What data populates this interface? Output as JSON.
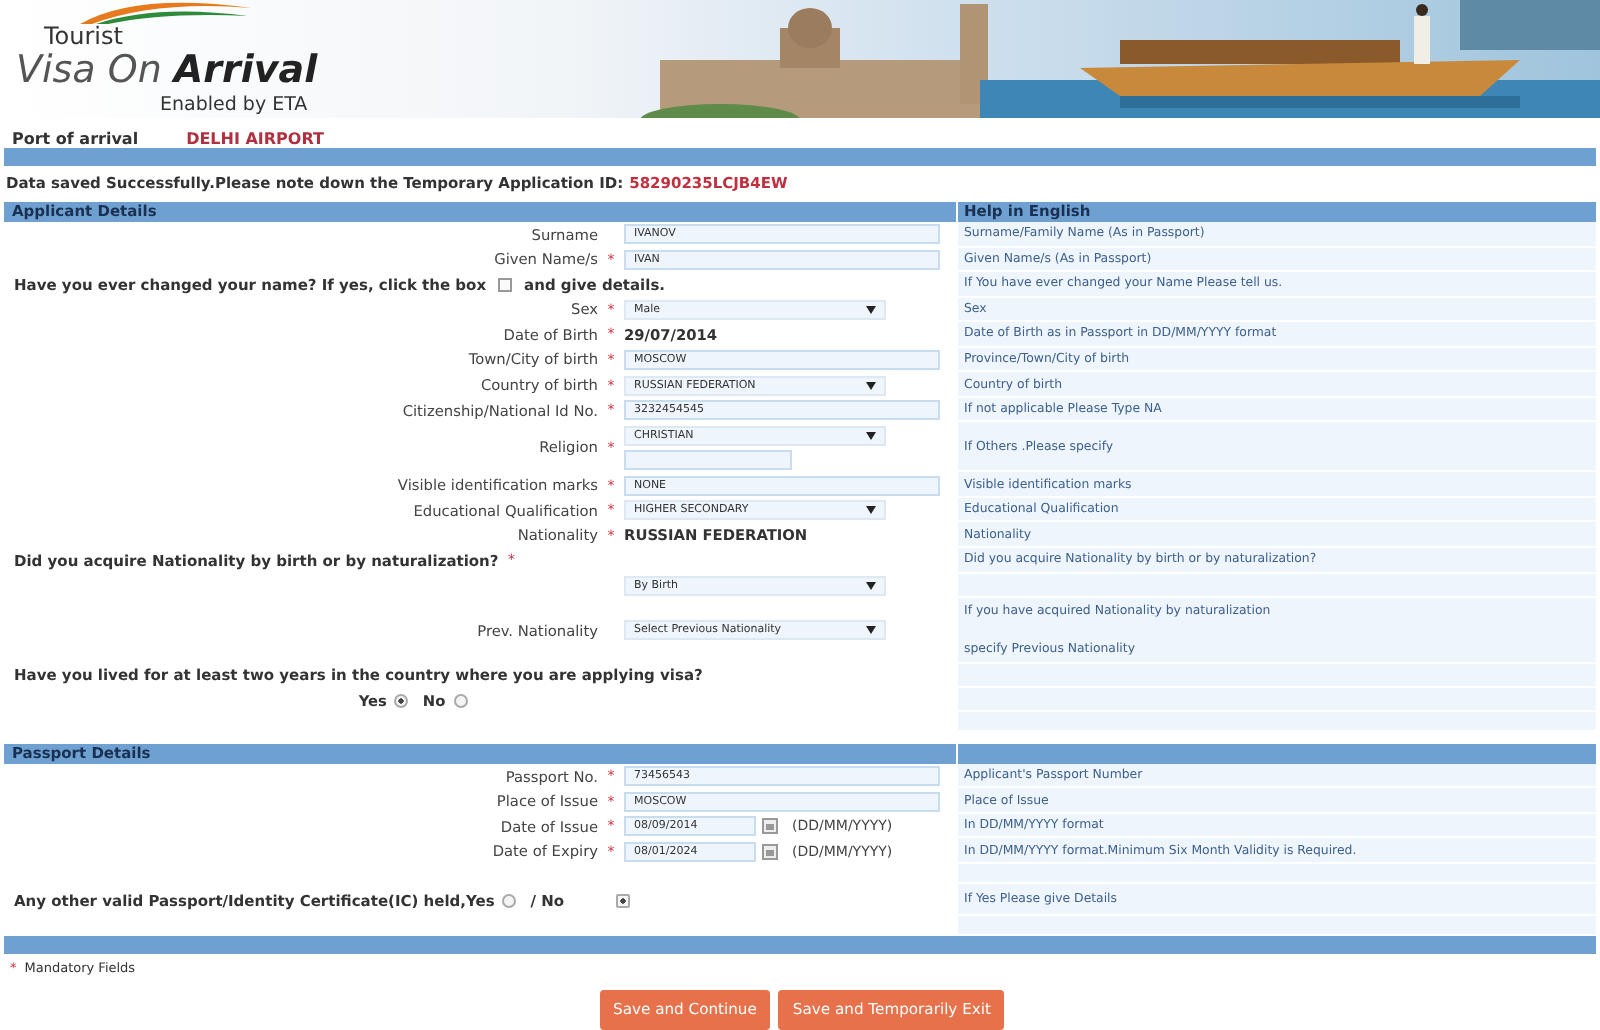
{
  "header": {
    "logo_small": "Tourist",
    "logo_title": "Visa On **Arrival**",
    "logo_tagline": "Enabled by ETA"
  },
  "port": {
    "label": "Port of arrival",
    "value": "DELHI AIRPORT"
  },
  "message": {
    "text": "Data saved Successfully.Please note down the Temporary Application ID:",
    "id": "58290235LCJB4EW"
  },
  "required_mark": "*",
  "sections": [
    {
      "title": "Applicant Details",
      "help_title": "Help in English",
      "rows": [
        {
          "kind": "input",
          "label": "Surname",
          "required": false,
          "value": "IVANOV",
          "help": [
            "Surname/Family Name (As in Passport)"
          ]
        },
        {
          "kind": "input",
          "label": "Given Name/s",
          "required": true,
          "value": "IVAN",
          "help": [
            "Given Name/s (As in Passport)"
          ]
        },
        {
          "kind": "checkbox_question",
          "text": "Have you ever changed your name? If yes, click the box",
          "text_after": "and give details.",
          "checked": false,
          "help": [
            "If You have ever changed your Name Please tell us."
          ]
        },
        {
          "kind": "select",
          "label": "Sex",
          "required": true,
          "value": "Male",
          "help": [
            "Sex"
          ]
        },
        {
          "kind": "static",
          "label": "Date of Birth",
          "required": true,
          "value": "29/07/2014",
          "help": [
            "Date of Birth as in Passport in DD/MM/YYYY format"
          ]
        },
        {
          "kind": "input",
          "label": "Town/City of birth",
          "required": true,
          "value": "MOSCOW",
          "help": [
            "Province/Town/City of birth"
          ]
        },
        {
          "kind": "select",
          "label": "Country of birth",
          "required": true,
          "value": "RUSSIAN FEDERATION",
          "help": [
            "Country of birth"
          ]
        },
        {
          "kind": "input",
          "label": "Citizenship/National Id No.",
          "required": true,
          "value": "3232454545",
          "help": [
            "If not applicable Please Type NA"
          ]
        },
        {
          "kind": "select_other",
          "label": "Religion",
          "required": true,
          "value": "CHRISTIAN",
          "help": [
            "If Others .Please specify"
          ]
        },
        {
          "kind": "input",
          "label": "Visible identification marks",
          "required": true,
          "value": "NONE",
          "help": [
            "Visible identification marks"
          ]
        },
        {
          "kind": "select",
          "label": "Educational Qualification",
          "required": true,
          "value": "HIGHER SECONDARY",
          "help": [
            "Educational Qualification"
          ]
        },
        {
          "kind": "static",
          "label": "Nationality",
          "required": true,
          "value": "RUSSIAN FEDERATION",
          "help": [
            "Nationality"
          ]
        },
        {
          "kind": "question",
          "text": "Did you acquire Nationality by birth or by naturalization?",
          "required": true,
          "help": [
            "Did you acquire Nationality by birth or by naturalization?"
          ]
        },
        {
          "kind": "select",
          "required": false,
          "value": "By Birth"
        },
        {
          "kind": "select",
          "label": "Prev. Nationality",
          "required": false,
          "value": "Select Previous Nationality",
          "help": [
            "If you have acquired Nationality by naturalization",
            "specify Previous Nationality"
          ]
        },
        {
          "kind": "question",
          "text": "Have you lived for at least two years in the country where you are applying visa?",
          "required": false
        },
        {
          "kind": "radio",
          "options": [
            {
              "label": "Yes",
              "selected": true
            },
            {
              "label": "No",
              "selected": false
            }
          ]
        },
        {
          "kind": "blank"
        }
      ]
    },
    {
      "title": "Passport Details",
      "rows": [
        {
          "kind": "input",
          "label": "Passport No.",
          "required": true,
          "value": "73456543",
          "help": [
            "Applicant's Passport Number"
          ]
        },
        {
          "kind": "input",
          "label": "Place of Issue",
          "required": true,
          "value": "MOSCOW",
          "help": [
            "Place of Issue"
          ]
        },
        {
          "kind": "date",
          "label": "Date of Issue",
          "required": true,
          "value": "08/09/2014",
          "hint": "(DD/MM/YYYY)",
          "help": [
            "In DD/MM/YYYY format"
          ]
        },
        {
          "kind": "date",
          "label": "Date of Expiry",
          "required": true,
          "value": "08/01/2024",
          "hint": "(DD/MM/YYYY)",
          "help": [
            "In DD/MM/YYYY format.Minimum Six Month Validity is Required."
          ]
        },
        {
          "kind": "blank"
        },
        {
          "kind": "radio_inline",
          "options": [
            {
              "label": "Any other valid Passport/Identity Certificate(IC) held,Yes",
              "selected": false
            },
            {
              "label": "/ No",
              "selected": true
            }
          ],
          "help": [
            "If Yes Please give Details"
          ]
        },
        {
          "kind": "blank"
        }
      ]
    }
  ],
  "footnote": "Mandatory Fields",
  "buttons": [
    "Save and Continue",
    "Save and Temporarily Exit"
  ]
}
